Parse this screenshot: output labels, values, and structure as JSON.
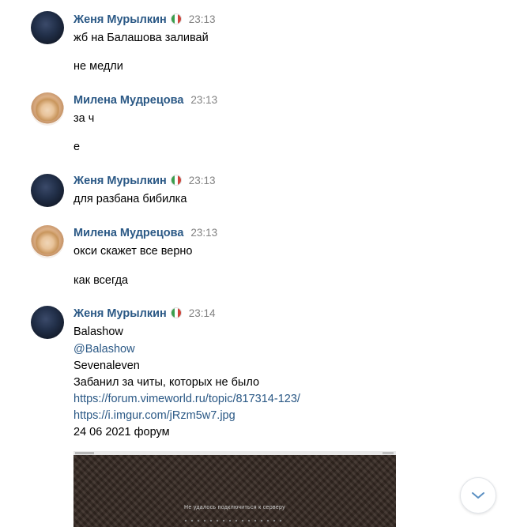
{
  "messages": [
    {
      "author": "Женя Мурылкин",
      "time": "23:13",
      "avatar": "dark-avatar",
      "flag": "italy-flag-icon",
      "lines": [
        "жб на Балашова заливай",
        "не медли"
      ]
    },
    {
      "author": "Милена Мудрецова",
      "time": "23:13",
      "avatar": "light-avatar",
      "lines": [
        "за ч",
        "е"
      ]
    },
    {
      "author": "Женя Мурылкин",
      "time": "23:13",
      "avatar": "dark-avatar",
      "flag": "italy-flag-icon",
      "lines": [
        "для разбана бибилка"
      ]
    },
    {
      "author": "Милена Мудрецова",
      "time": "23:13",
      "avatar": "light-avatar",
      "lines": [
        "окси скажет все верно",
        "как всегда"
      ]
    },
    {
      "author": "Женя Мурылкин",
      "time": "23:14",
      "avatar": "dark-avatar",
      "flag": "italy-flag-icon",
      "lines": [
        "Balashow",
        "Sevenaleven",
        "Забанил за читы, которых не было",
        "24 06 2021 форум"
      ],
      "mention": "@Balashow",
      "links": [
        "https://forum.vimeworld.ru/topic/817314-123/",
        "https://i.imgur.com/jRzm5w7.jpg"
      ],
      "attachment": {
        "caption": "Не удалось подключиться к серверу"
      }
    }
  ],
  "scroll_button": {
    "icon": "chevron-down-icon"
  },
  "colors": {
    "link": "#2a5885",
    "time": "#828282",
    "text": "#000000"
  }
}
